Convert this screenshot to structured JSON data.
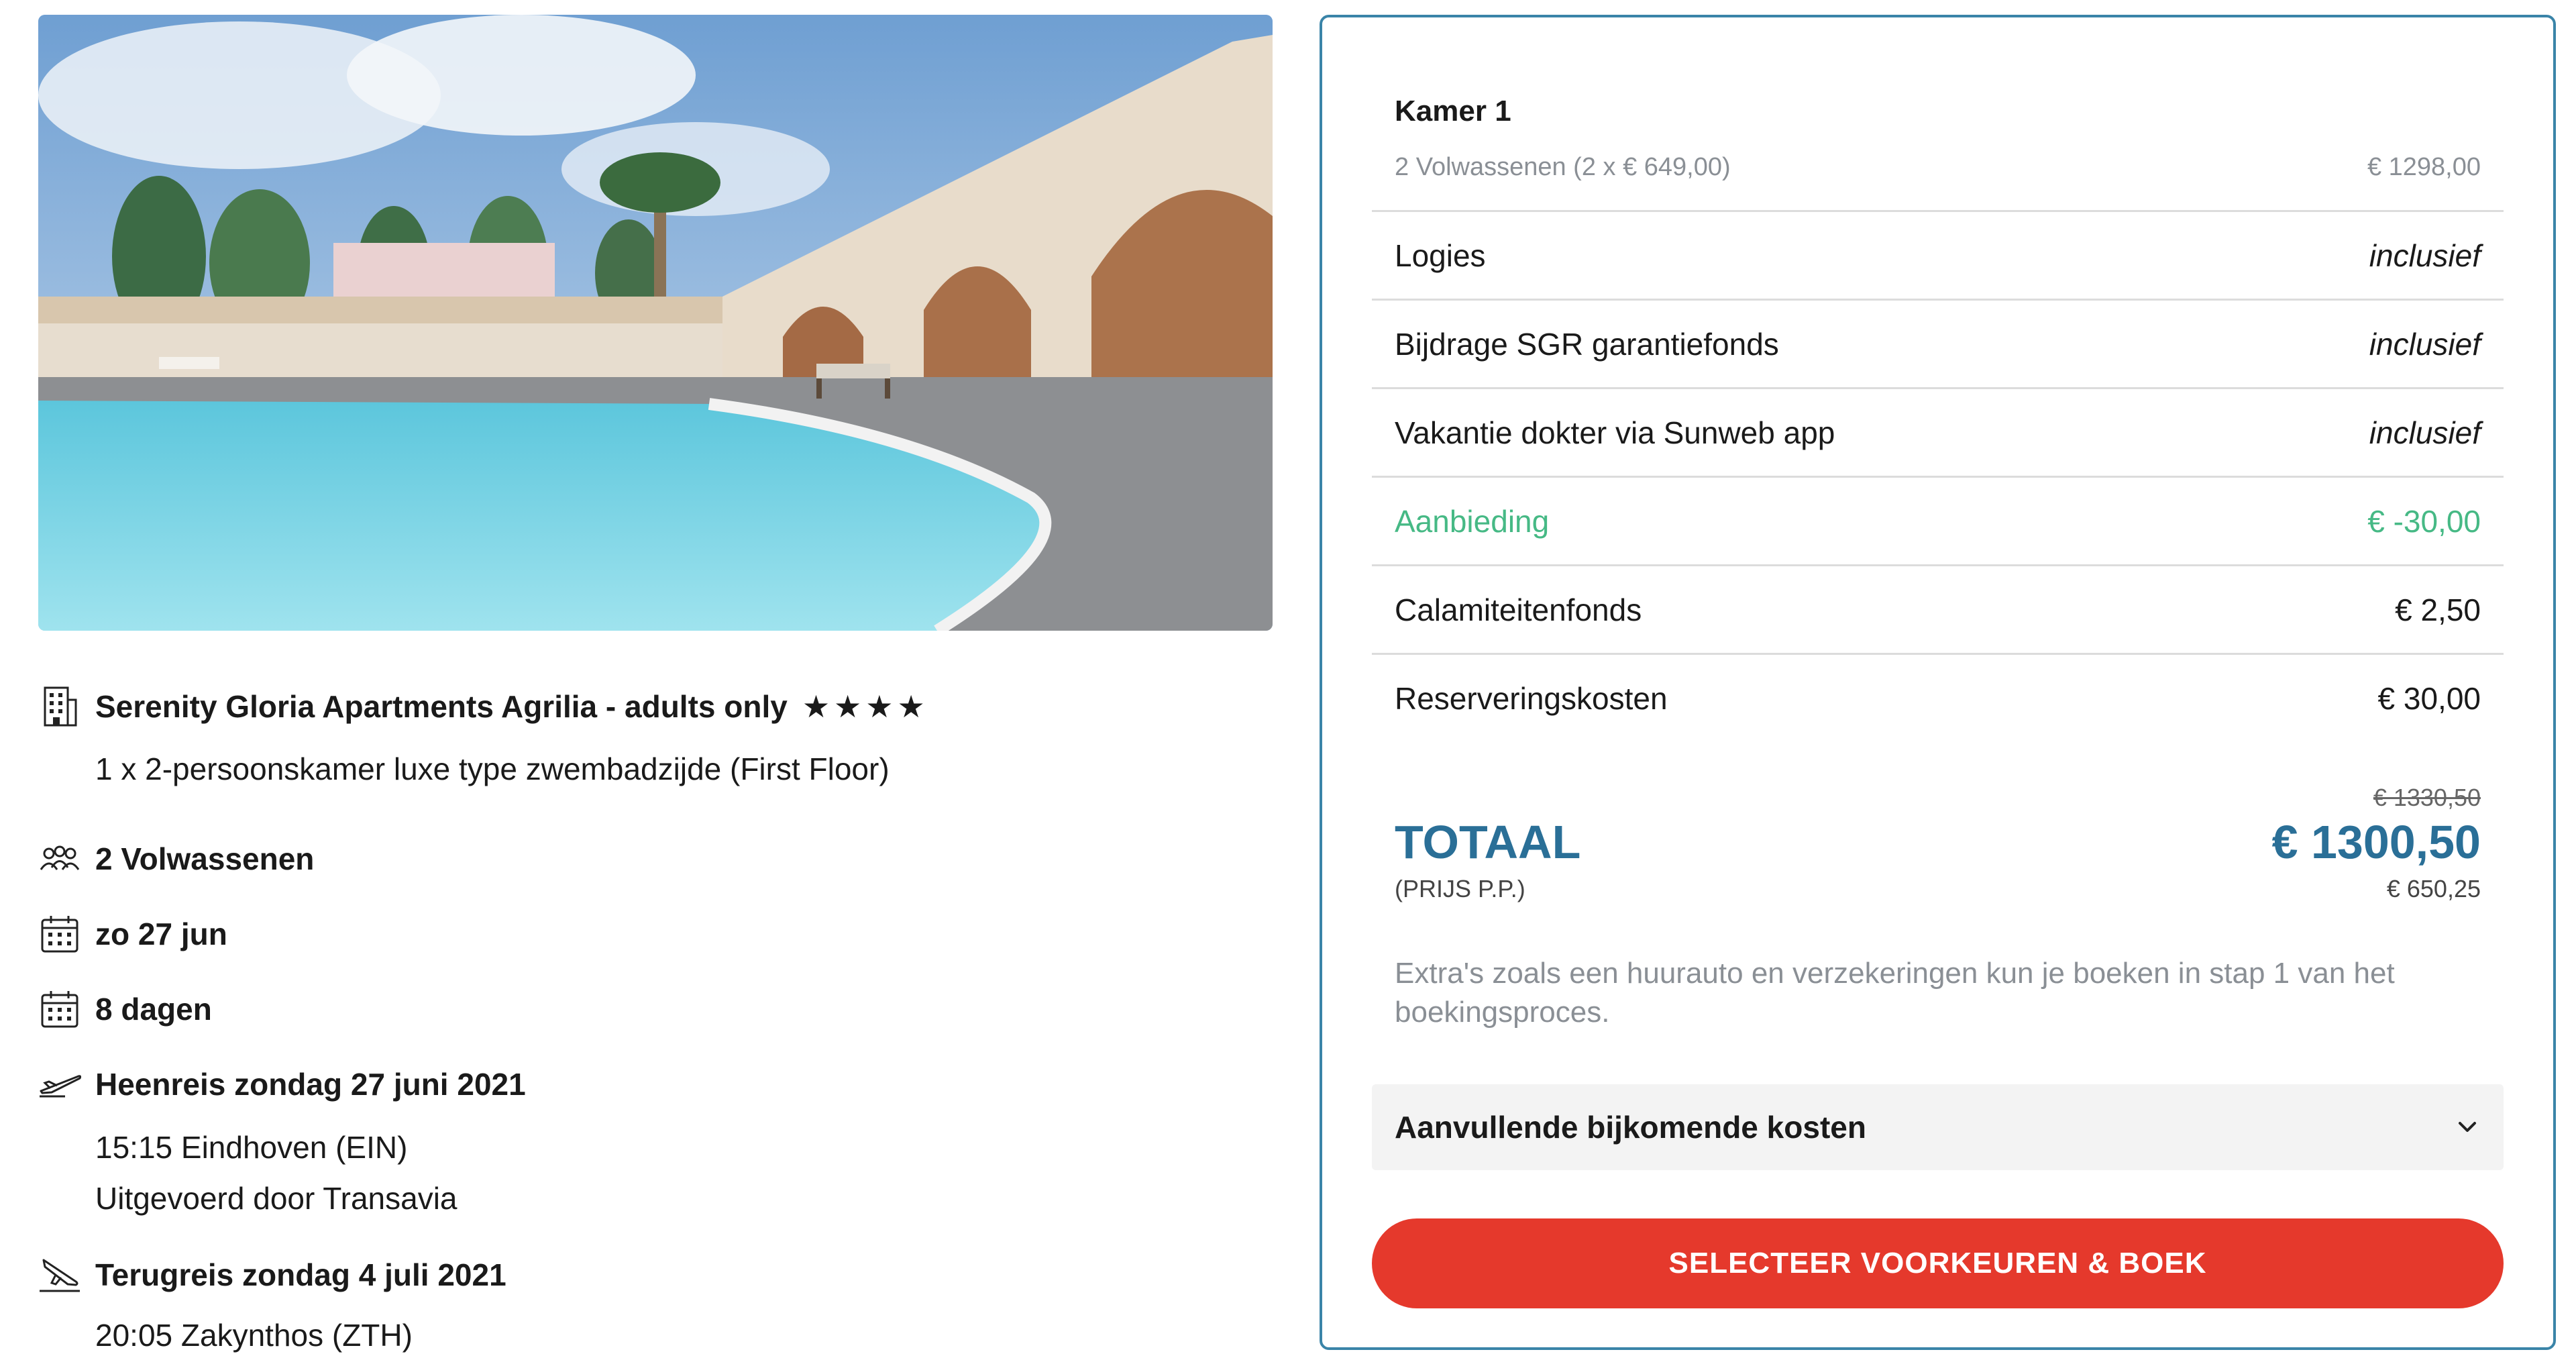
{
  "accommodation": {
    "name": "Serenity Gloria Apartments Agrilia - adults only",
    "stars": 4,
    "stars_text": "★★★★",
    "room": "1 x 2-persoonskamer luxe type zwembadzijde (First Floor)"
  },
  "travellers": "2 Volwassenen",
  "departure_date": "zo 27 jun",
  "duration": "8 dagen",
  "outbound": {
    "title": "Heenreis zondag 27 juni 2021",
    "time_airport": "15:15 Eindhoven (EIN)",
    "carrier": "Uitgevoerd door Transavia"
  },
  "return": {
    "title": "Terugreis zondag 4 juli 2021",
    "time_airport": "20:05 Zakynthos (ZTH)"
  },
  "summary": {
    "room_title": "Kamer 1",
    "room_sub_label": "2 Volwassenen (2 x € 649,00)",
    "room_sub_value": "€ 1298,00",
    "lines": [
      {
        "label": "Logies",
        "value": "inclusief"
      },
      {
        "label": "Bijdrage SGR garantiefonds",
        "value": "inclusief"
      },
      {
        "label": "Vakantie dokter via Sunweb app",
        "value": "inclusief"
      },
      {
        "label": "Aanbieding",
        "value": "€ -30,00"
      },
      {
        "label": "Calamiteitenfonds",
        "value": "€ 2,50"
      },
      {
        "label": "Reserveringskosten",
        "value": "€ 30,00"
      }
    ],
    "old_total": "€ 1330,50",
    "total_label": "TOTAAL",
    "total_value": "€ 1300,50",
    "pp_label": "(PRIJS P.P.)",
    "pp_value": "€ 650,25",
    "extras_note": "Extra's zoals een huurauto en verzekeringen kun je boeken in stap 1 van het boekingsproces.",
    "accordion_label": "Aanvullende bijkomende kosten",
    "book_button": "SELECTEER VOORKEUREN & BOEK"
  },
  "colors": {
    "accent_blue": "#2a6f97",
    "card_border": "#3a84a8",
    "discount_green": "#46b985",
    "button_red": "#e5392c"
  }
}
